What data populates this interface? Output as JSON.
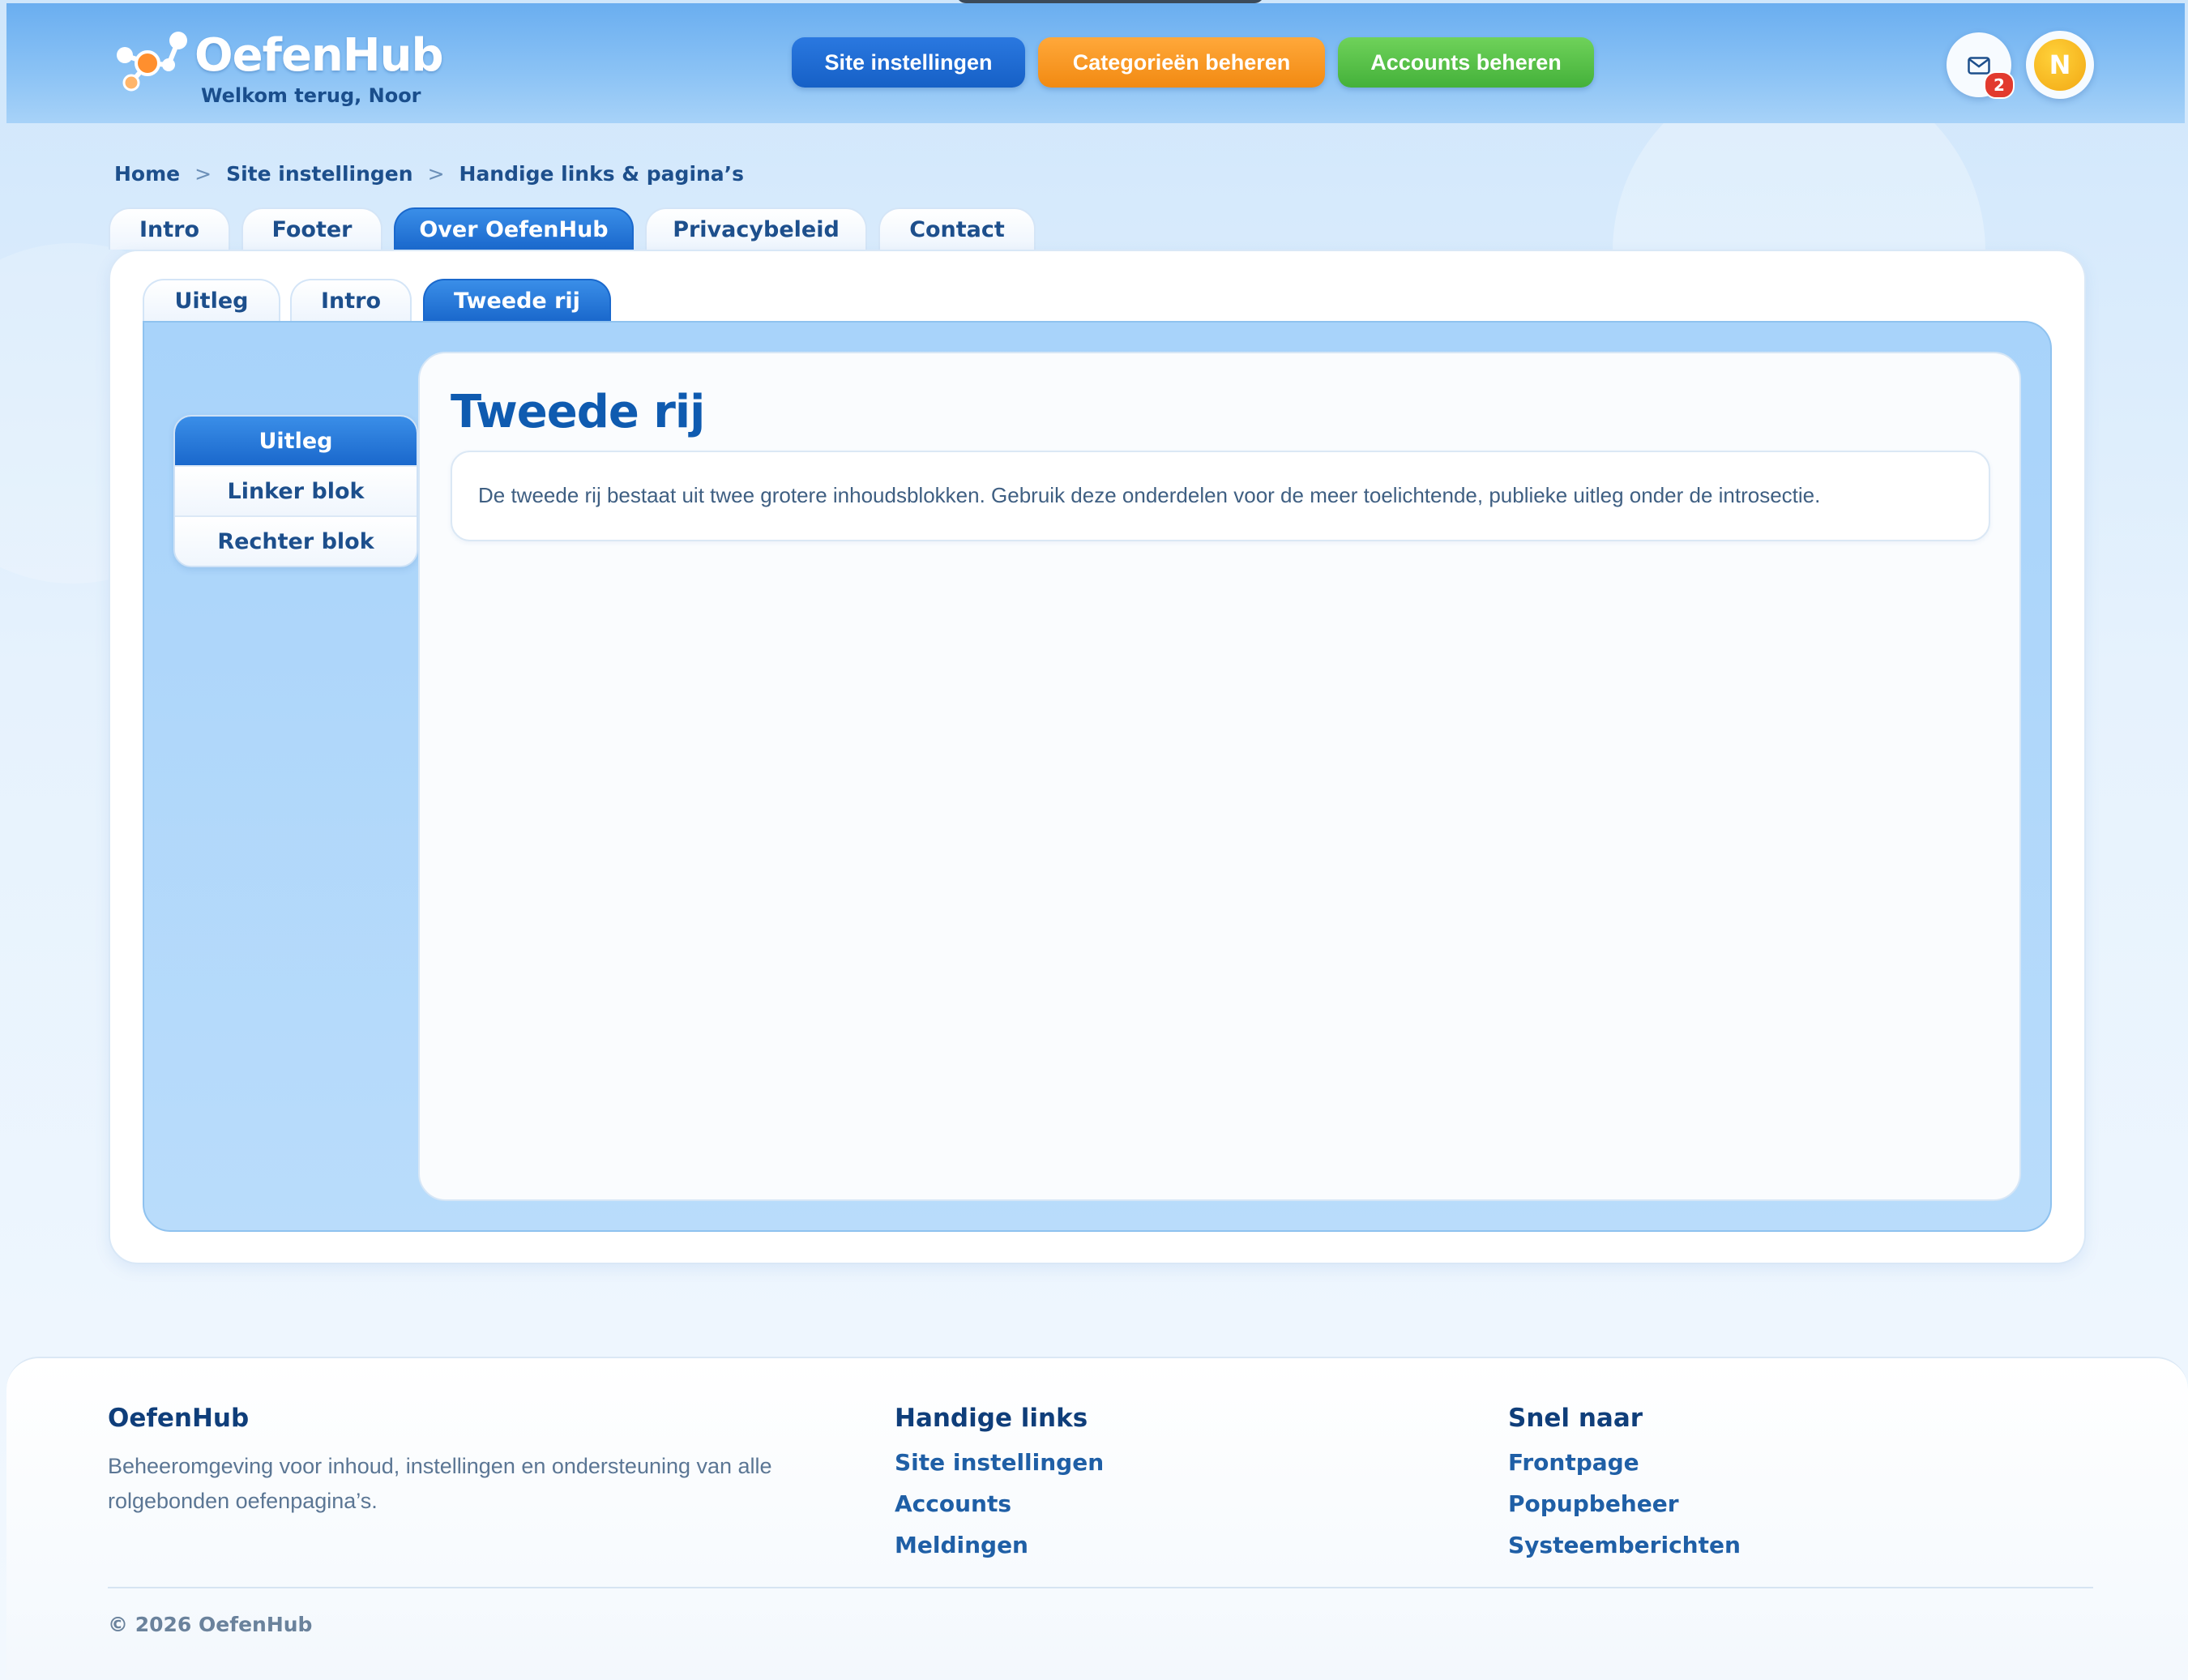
{
  "header": {
    "logo_text": "OefenHub",
    "welcome": "Welkom terug, Noor",
    "nav": {
      "site_settings": "Site instellingen",
      "categories": "Categorieën beheren",
      "accounts": "Accounts beheren"
    },
    "mail_badge": "2",
    "avatar_initial": "N"
  },
  "breadcrumb": {
    "home": "Home",
    "sep": ">",
    "site_settings": "Site instellingen",
    "current": "Handige links & pagina’s"
  },
  "tabs": [
    "Intro",
    "Footer",
    "Over OefenHub",
    "Privacybeleid",
    "Contact"
  ],
  "tabs_active": "Over OefenHub",
  "subtabs": [
    "Uitleg",
    "Intro",
    "Tweede rij"
  ],
  "subtabs_active": "Tweede rij",
  "sidenav": [
    "Uitleg",
    "Linker blok",
    "Rechter blok"
  ],
  "sidenav_active": "Uitleg",
  "content": {
    "title": "Tweede rij",
    "description": "De tweede rij bestaat uit twee grotere inhoudsblokken. Gebruik deze onderdelen voor de meer toelichtende, publieke uitleg onder de introsectie."
  },
  "footer": {
    "brand": {
      "title": "OefenHub",
      "text": "Beheeromgeving voor inhoud, instellingen en ondersteuning van alle rolgebonden oefenpagina’s."
    },
    "links": {
      "title": "Handige links",
      "items": [
        "Site instellingen",
        "Accounts",
        "Meldingen"
      ]
    },
    "quick": {
      "title": "Snel naar",
      "items": [
        "Frontpage",
        "Popupbeheer",
        "Systeemberichten"
      ]
    },
    "copyright": "© 2026 OefenHub"
  },
  "colors": {
    "primary": "#1a68cc",
    "orange": "#f28a12",
    "green": "#44b13a",
    "badge": "#e23a2e"
  }
}
